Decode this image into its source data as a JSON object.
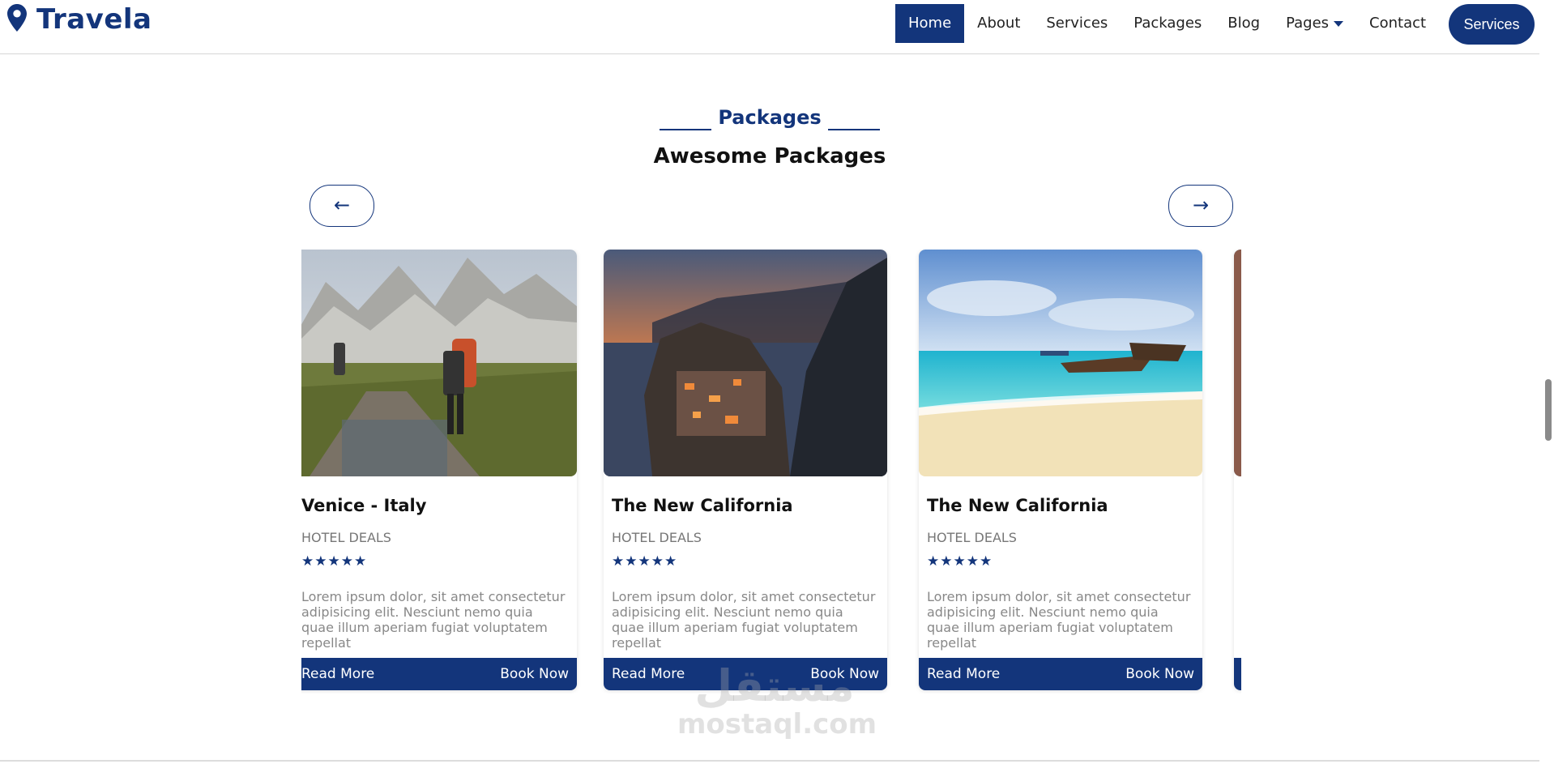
{
  "brand": {
    "name": "Travela",
    "icon": "map-pin-icon",
    "color": "#13357B"
  },
  "nav": {
    "items": [
      "Home",
      "About",
      "Services",
      "Packages",
      "Blog",
      "Pages",
      "Contact"
    ],
    "active": "Home",
    "cta": "Services"
  },
  "section": {
    "subtitle": "Packages",
    "title": "Awesome Packages"
  },
  "carousel": {
    "prev": "←",
    "next": "→"
  },
  "packages": [
    {
      "title": "Venice - Italy",
      "tag": "HOTEL DEALS",
      "stars": "★★★★★",
      "text": "Lorem ipsum dolor, sit amet consectetur adipisicing elit. Nesciunt nemo quia quae illum aperiam fugiat voluptatem repellat",
      "read_more": "Read More",
      "book_now": "Book Now",
      "image": "mountain-hiking-photo"
    },
    {
      "title": "The New California",
      "tag": "HOTEL DEALS",
      "stars": "★★★★★",
      "text": "Lorem ipsum dolor, sit amet consectetur adipisicing elit. Nesciunt nemo quia quae illum aperiam fugiat voluptatem repellat",
      "read_more": "Read More",
      "book_now": "Book Now",
      "image": "coastal-town-sunset-photo"
    },
    {
      "title": "The New California",
      "tag": "HOTEL DEALS",
      "stars": "★★★★★",
      "text": "Lorem ipsum dolor, sit amet consectetur adipisicing elit. Nesciunt nemo quia quae illum aperiam fugiat voluptatem repellat",
      "read_more": "Read More",
      "book_now": "Book Now",
      "image": "tropical-beach-boat-photo"
    }
  ],
  "watermark": {
    "arabic": "مستقل",
    "latin": "mostaql.com"
  }
}
